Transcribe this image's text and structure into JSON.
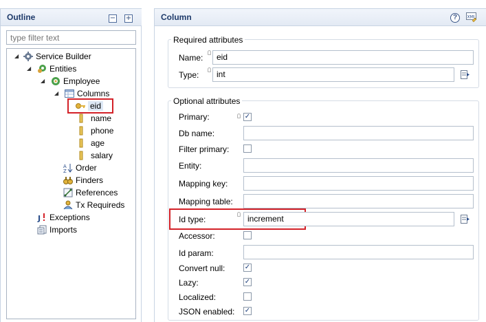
{
  "outline": {
    "title": "Outline",
    "collapse_icon": "collapse-all-icon",
    "expand_icon": "expand-all-icon",
    "filter_placeholder": "type filter text",
    "tree": {
      "service_builder": "Service Builder",
      "entities": "Entities",
      "employee": "Employee",
      "columns": "Columns",
      "eid": "eid",
      "name": "name",
      "phone": "phone",
      "age": "age",
      "salary": "salary",
      "order": "Order",
      "finders": "Finders",
      "references": "References",
      "tx_requireds": "Tx Requireds",
      "exceptions": "Exceptions",
      "imports": "Imports"
    }
  },
  "column": {
    "title": "Column",
    "help_icon": "?",
    "xml_icon": "XML",
    "required": {
      "title": "Required attributes",
      "name_label": "Name:",
      "name_value": "eid",
      "type_label": "Type:",
      "type_value": "int"
    },
    "optional": {
      "title": "Optional attributes",
      "primary_label": "Primary:",
      "primary_checked": true,
      "db_name_label": "Db name:",
      "db_name_value": "",
      "filter_primary_label": "Filter primary:",
      "filter_primary_checked": false,
      "entity_label": "Entity:",
      "entity_value": "",
      "mapping_key_label": "Mapping key:",
      "mapping_key_value": "",
      "mapping_table_label": "Mapping table:",
      "mapping_table_value": "",
      "id_type_label": "Id type:",
      "id_type_value": "increment",
      "accessor_label": "Accessor:",
      "accessor_checked": false,
      "id_param_label": "Id param:",
      "id_param_value": "",
      "convert_null_label": "Convert null:",
      "convert_null_checked": true,
      "lazy_label": "Lazy:",
      "lazy_checked": true,
      "localized_label": "Localized:",
      "localized_checked": false,
      "json_enabled_label": "JSON enabled:",
      "json_enabled_checked": true
    }
  },
  "colors": {
    "header_text": "#1e3a6a",
    "highlight_box": "#d32027"
  }
}
